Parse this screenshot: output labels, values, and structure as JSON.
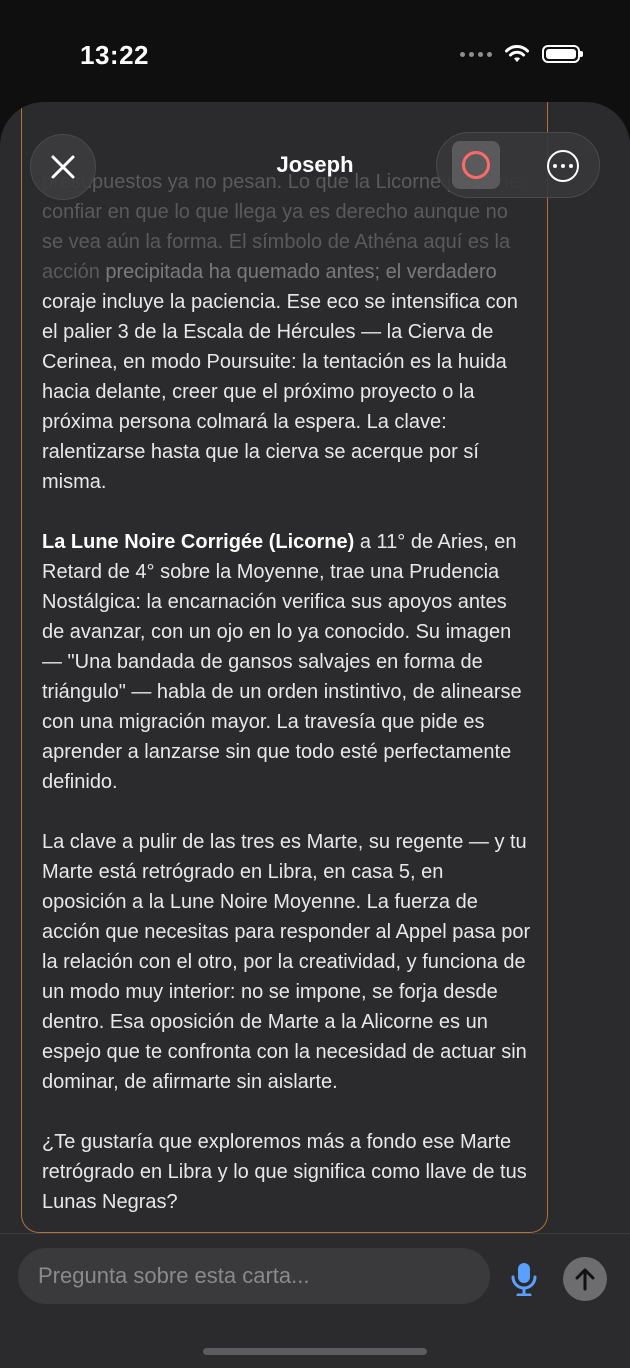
{
  "status_bar": {
    "time": "13:22"
  },
  "header": {
    "title": "Joseph"
  },
  "message": {
    "faded_lines": [
      "presupuestos ya no pesan. Lo que la Licorne",
      "propone: confiar en que lo que llega ya es",
      "derecho aunque no se vea aún la forma. El",
      "símbolo de Athéna aquí es la acción",
      "precipitada ha quemado antes; el verdadero"
    ],
    "para1_rest": "coraje incluye la paciencia. Ese eco se intensifica con el palier 3 de la Escala de Hércules — la Cierva de Cerinea, en modo Poursuite: la tentación es la huida hacia delante, creer que el próximo proyecto o la próxima persona colmará la espera. La clave: ralentizarse hasta que la cierva se acerque por sí misma.",
    "para2_bold": "La Lune Noire Corrigée (Licorne)",
    "para2_rest": " a 11° de Aries, en Retard de 4° sobre la Moyenne, trae una Prudencia Nostálgica: la encarnación verifica sus apoyos antes de avanzar, con un ojo en lo ya conocido. Su imagen — \"Una bandada de gansos salvajes en forma de triángulo\" — habla de un orden instintivo, de alinearse con una migración mayor. La travesía que pide es aprender a lanzarse sin que todo esté perfectamente definido.",
    "para3": "La clave a pulir de las tres es Marte, su regente — y tu Marte está retrógrado en Libra, en casa 5, en oposición a la Lune Noire Moyenne. La fuerza de acción que necesitas para responder al Appel pasa por la relación con el otro, por la creatividad, y funciona de un modo muy interior: no se impone, se forja desde dentro. Esa oposición de Marte a la Alicorne es un espejo que te confronta con la necesidad de actuar sin dominar, de afirmarte sin aislarte.",
    "para4": "¿Te gustaría que exploremos más a fondo ese Marte retrógrado en Libra y lo que significa como llave de tus Lunas Negras?"
  },
  "composer": {
    "placeholder": "Pregunta sobre esta carta..."
  },
  "colors": {
    "accent_border": "#b0733a",
    "record_ring": "#ff6b6b",
    "mic": "#5aa0ff"
  },
  "icons": [
    "close-icon",
    "record-icon",
    "more-icon",
    "microphone-icon",
    "send-arrow-icon",
    "wifi-icon",
    "battery-icon"
  ]
}
